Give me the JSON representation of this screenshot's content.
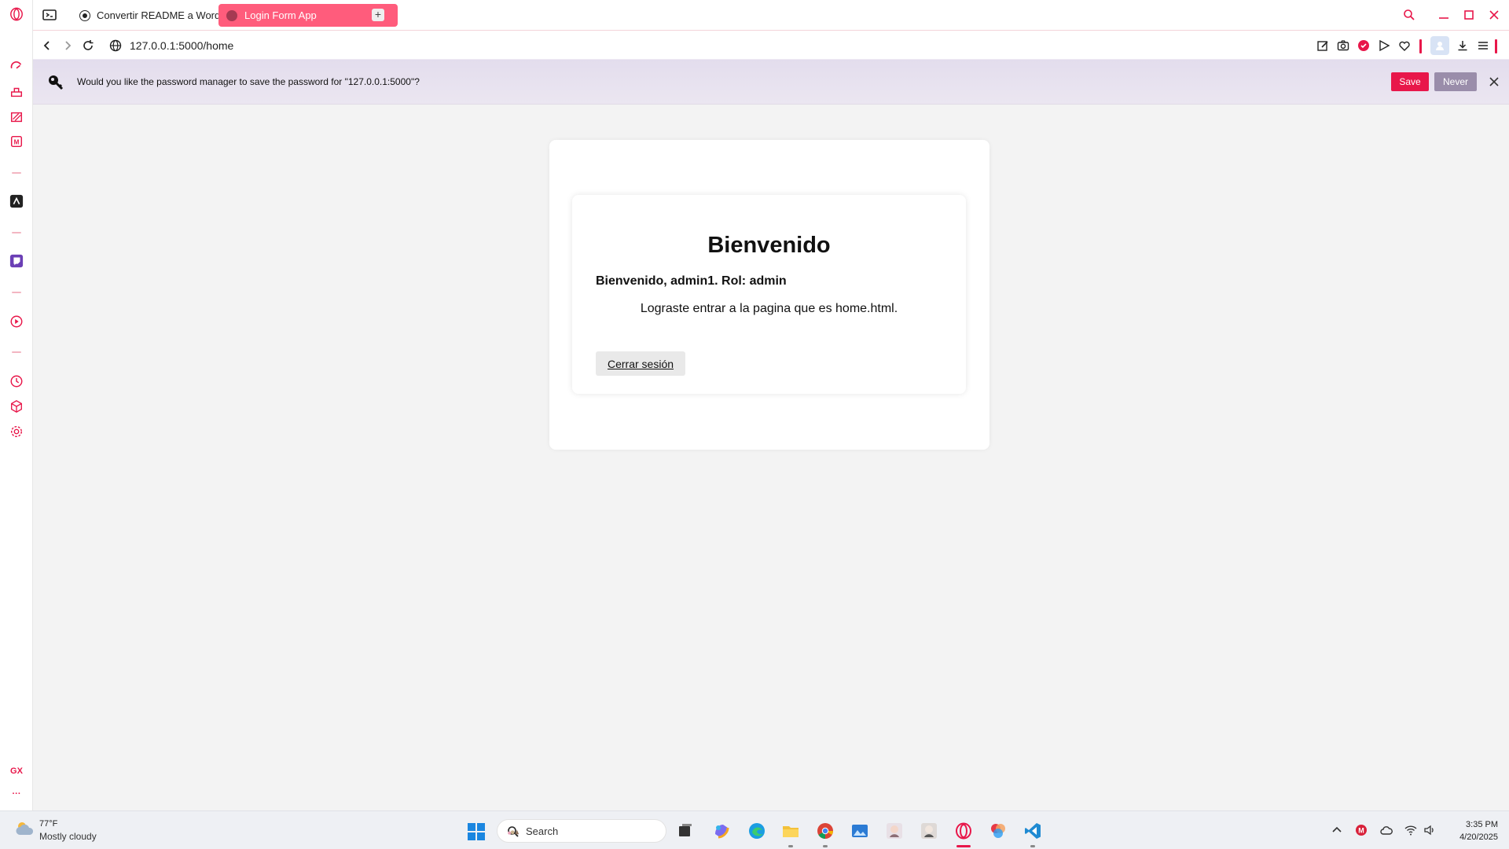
{
  "browser": {
    "tabs": [
      {
        "label": "Convertir README a Word",
        "active": false
      },
      {
        "label": "Login Form App",
        "active": true
      }
    ],
    "new_tab_label": "+",
    "url": "127.0.0.1:5000/home",
    "accent_color": "#e8174a",
    "sidebar_footer_label": "GX",
    "sidebar_more_label": "···"
  },
  "password_prompt": {
    "message": "Would you like the password manager to save the password for \"127.0.0.1:5000\"?",
    "save_label": "Save",
    "never_label": "Never"
  },
  "page": {
    "title": "Bienvenido",
    "welcome": "Bienvenido, admin1. Rol: admin",
    "message": "Lograste entrar a la pagina que es home.html.",
    "logout_label": "Cerrar sesión"
  },
  "taskbar": {
    "weather_temp": "77°F",
    "weather_desc": "Mostly cloudy",
    "search_placeholder": "Search",
    "time": "3:35 PM",
    "date": "4/20/2025"
  }
}
